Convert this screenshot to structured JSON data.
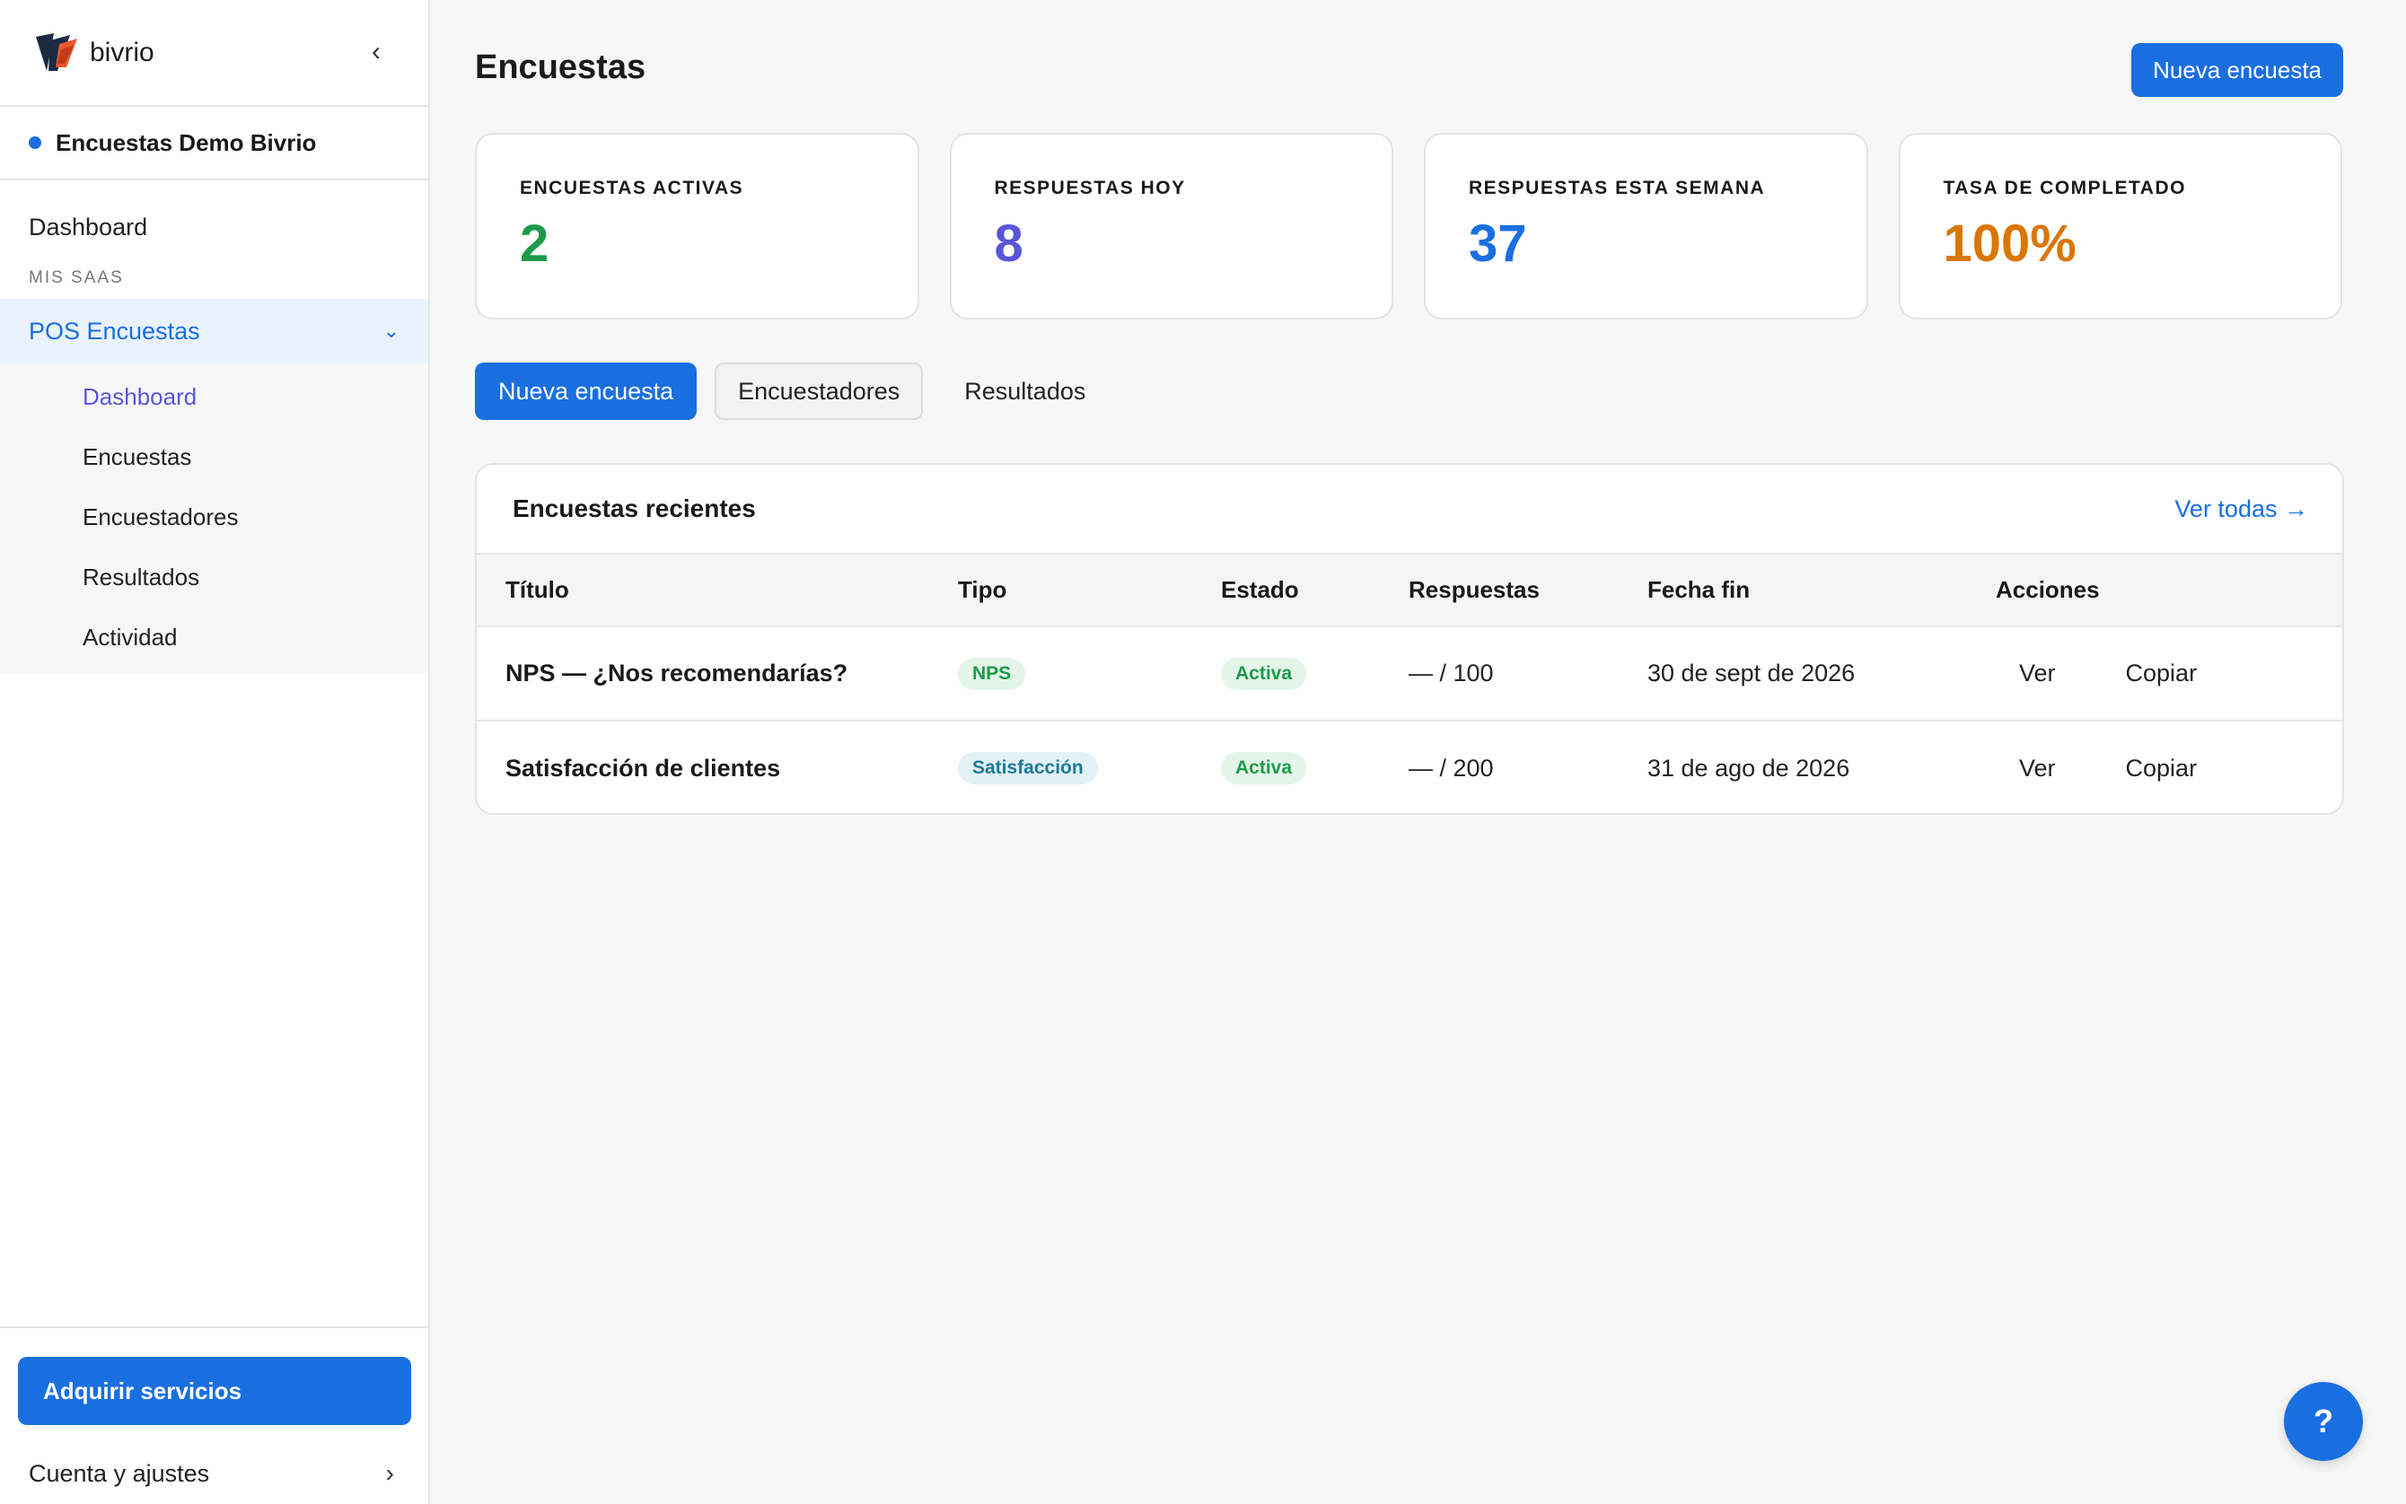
{
  "brand": {
    "name": "bivrio"
  },
  "workspace": {
    "name": "Encuestas Demo Bivrio",
    "dot_color": "#1a6fe0"
  },
  "sidebar": {
    "dashboard": "Dashboard",
    "section_label": "MIS SAAS",
    "group": {
      "label": "POS Encuestas",
      "items": [
        {
          "label": "Dashboard",
          "active": true
        },
        {
          "label": "Encuestas"
        },
        {
          "label": "Encuestadores"
        },
        {
          "label": "Resultados"
        },
        {
          "label": "Actividad"
        }
      ]
    },
    "acquire_button": "Adquirir servicios",
    "account": "Cuenta y ajustes"
  },
  "header": {
    "title": "Encuestas",
    "new_button": "Nueva encuesta"
  },
  "stats": [
    {
      "label": "ENCUESTAS ACTIVAS",
      "value": "2",
      "color": "#1f9a4d"
    },
    {
      "label": "RESPUESTAS HOY",
      "value": "8",
      "color": "#5a56d8"
    },
    {
      "label": "RESPUESTAS ESTA SEMANA",
      "value": "37",
      "color": "#1a6fe0"
    },
    {
      "label": "TASA DE COMPLETADO",
      "value": "100%",
      "color": "#d97706"
    }
  ],
  "tabs": [
    {
      "label": "Nueva encuesta",
      "style": "active"
    },
    {
      "label": "Encuestadores",
      "style": "outlined"
    },
    {
      "label": "Resultados",
      "style": "plain"
    }
  ],
  "recent": {
    "title": "Encuestas recientes",
    "see_all": "Ver todas →",
    "columns": [
      "Título",
      "Tipo",
      "Estado",
      "Respuestas",
      "Fecha fin",
      "Acciones"
    ],
    "rows": [
      {
        "title": "NPS — ¿Nos recomendarías?",
        "type": "NPS",
        "state": "Activa",
        "responses": "— / 100",
        "end_date": "30 de sept de 2026",
        "view": "Ver",
        "copy": "Copiar"
      },
      {
        "title": "Satisfacción de clientes",
        "type": "Satisfacción",
        "state": "Activa",
        "responses": "— / 200",
        "end_date": "31 de ago de 2026",
        "view": "Ver",
        "copy": "Copiar"
      }
    ]
  },
  "help": {
    "label": "?"
  },
  "colors": {
    "accent": "#1a6fe0",
    "success": "#1f9a4d"
  }
}
